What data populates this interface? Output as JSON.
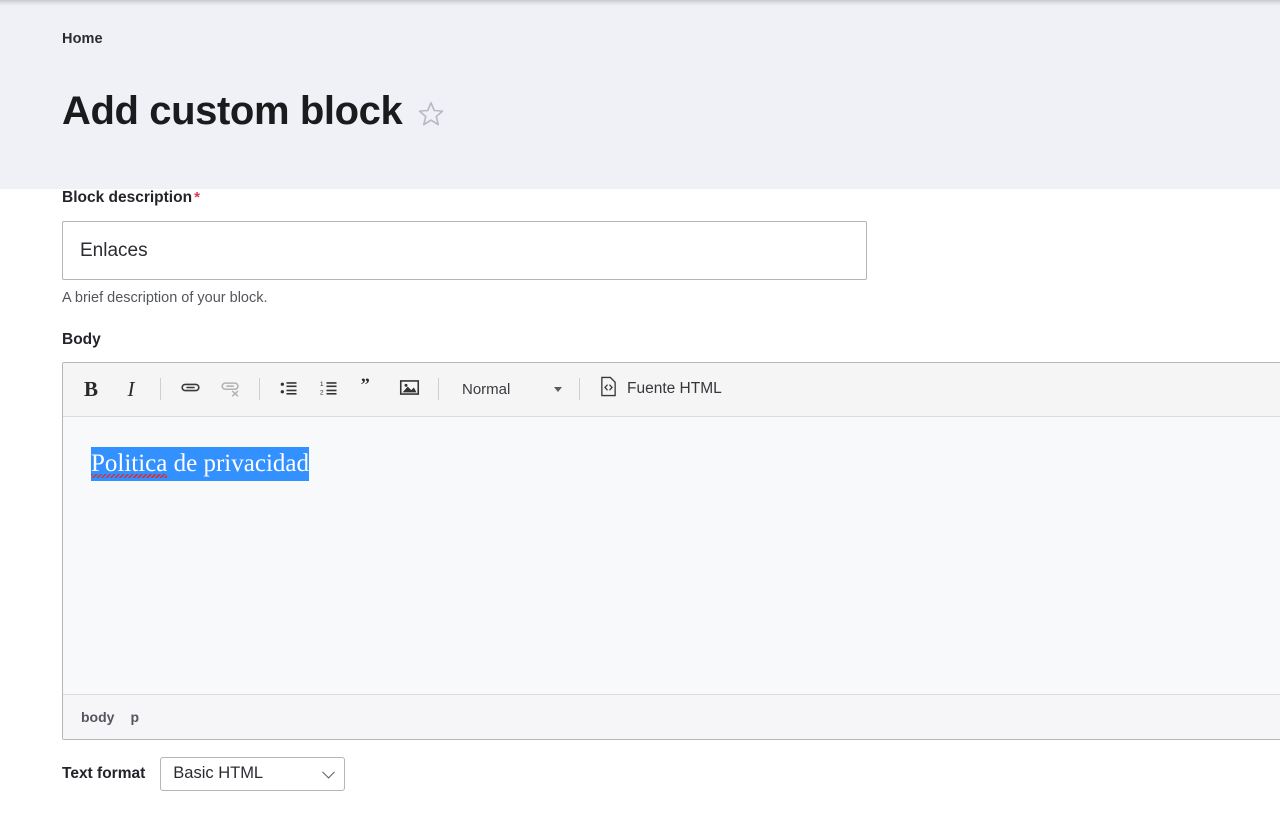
{
  "header": {
    "breadcrumb": "Home",
    "title": "Add custom block",
    "star_icon": "star-outline-icon"
  },
  "form": {
    "description_field": {
      "label": "Block description",
      "required_marker": "*",
      "value": "Enlaces",
      "placeholder": "",
      "help_text": "A brief description of your block."
    },
    "body_field": {
      "label": "Body",
      "editor": {
        "toolbar": {
          "bold": "B",
          "italic": "I",
          "link_icon": "link-icon",
          "unlink_icon": "unlink-icon",
          "bulleted_list_icon": "bulleted-list-icon",
          "numbered_list_icon": "numbered-list-icon",
          "blockquote_icon": "blockquote-icon",
          "image_icon": "image-icon",
          "paragraph_format": "Normal",
          "source_label": "Fuente HTML",
          "source_icon": "source-code-icon"
        },
        "content": {
          "selected_text": "Politica de privacidad",
          "misspelled_word": "Politica",
          "rest_text": " de privacidad",
          "selection_color": "#3390ff",
          "selection_text_color": "#ffffff",
          "spellcheck_underline_color": "#e02b2b"
        },
        "status_path": [
          "body",
          "p"
        ]
      }
    },
    "text_format": {
      "label": "Text format",
      "selected": "Basic HTML",
      "caret_icon": "chevron-down-icon"
    }
  },
  "colors": {
    "header_background": "#f0f1f6",
    "required_asterisk": "#e3344a",
    "toolbar_background": "#f5f5f5",
    "editor_body_background": "#f8f9fb"
  }
}
